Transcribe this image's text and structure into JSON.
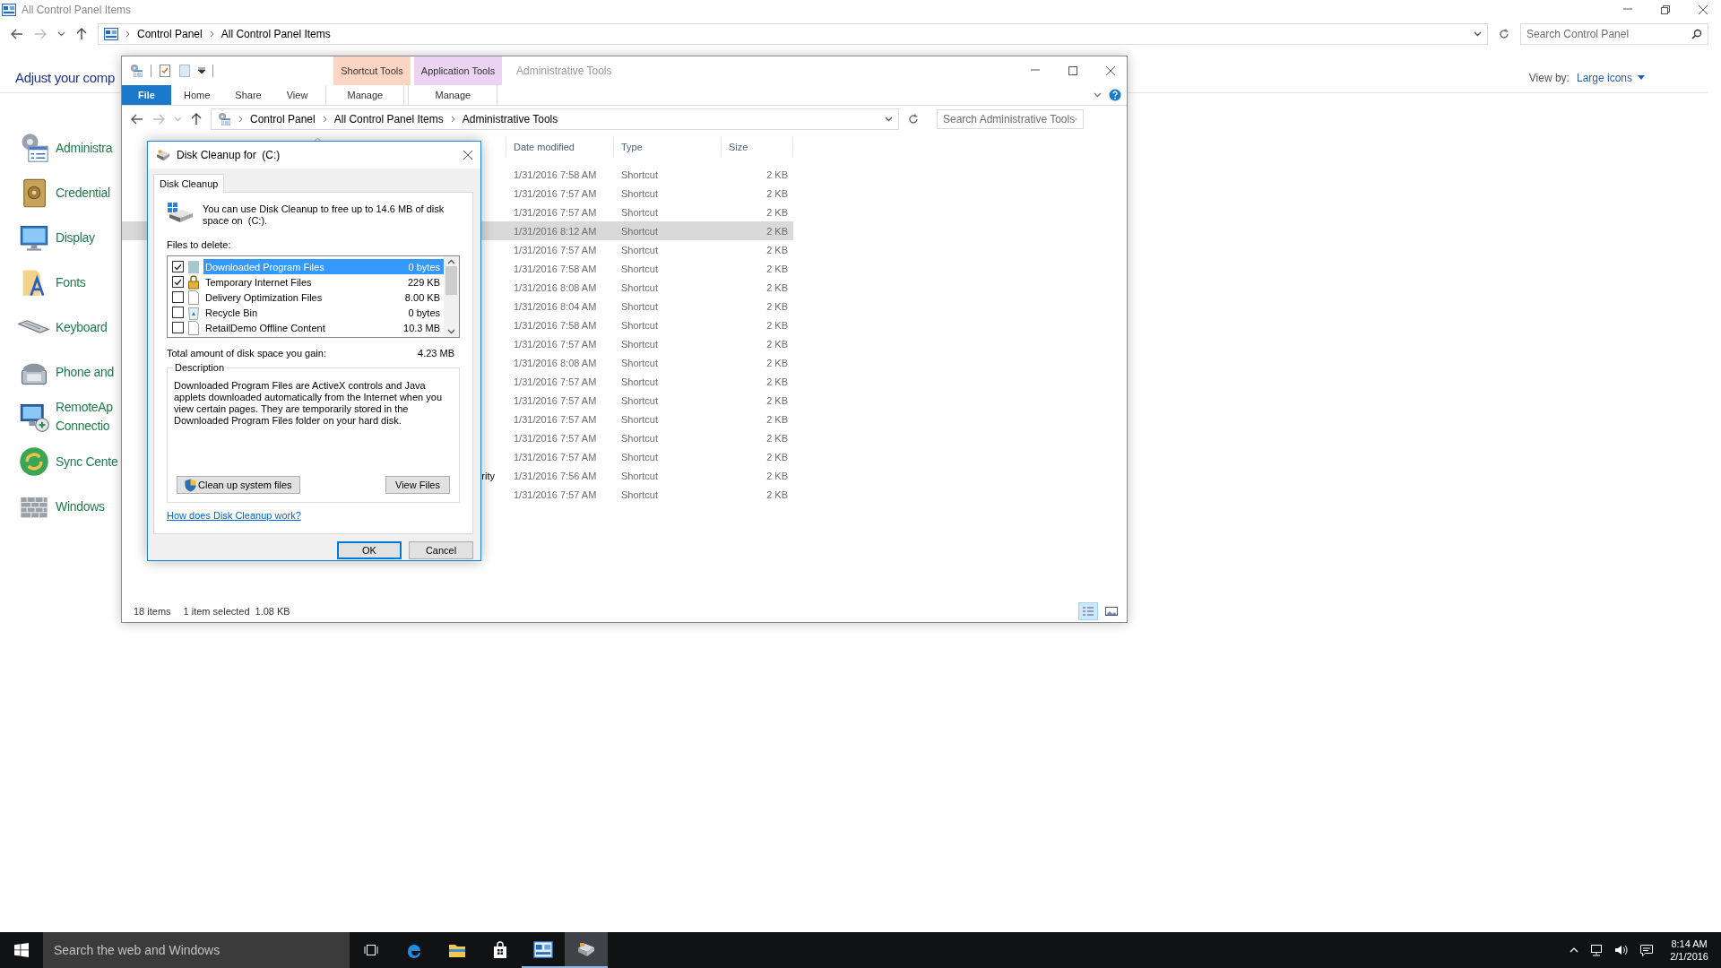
{
  "control_panel": {
    "title": "All Control Panel Items",
    "breadcrumbs": [
      "Control Panel",
      "All Control Panel Items"
    ],
    "search": {
      "placeholder": "Search Control Panel"
    },
    "heading": "Adjust your comp",
    "view_by": {
      "label": "View by:",
      "value": "Large icons"
    },
    "items": [
      {
        "kind": "admin",
        "lines": [
          "Administra"
        ]
      },
      {
        "kind": "credential",
        "lines": [
          "Credential"
        ]
      },
      {
        "kind": "display",
        "lines": [
          "Display"
        ]
      },
      {
        "kind": "fonts",
        "lines": [
          "Fonts"
        ]
      },
      {
        "kind": "keyboard",
        "lines": [
          "Keyboard"
        ]
      },
      {
        "kind": "phone",
        "lines": [
          "Phone and"
        ]
      },
      {
        "kind": "remote",
        "lines": [
          "RemoteAp",
          "Connectio"
        ]
      },
      {
        "kind": "sync",
        "lines": [
          "Sync Cente"
        ]
      },
      {
        "kind": "firewall",
        "lines": [
          "Windows"
        ]
      }
    ]
  },
  "explorer": {
    "title": "Administrative Tools",
    "contextual_groups": [
      {
        "label": "Shortcut Tools",
        "color": "#fcd6c3",
        "tab": "Manage"
      },
      {
        "label": "Application Tools",
        "color": "#ecd3f3",
        "tab": "Manage"
      }
    ],
    "tabs": [
      {
        "label": "File",
        "kind": "file"
      },
      {
        "label": "Home",
        "kind": "plain"
      },
      {
        "label": "Share",
        "kind": "plain"
      },
      {
        "label": "View",
        "kind": "plain"
      }
    ],
    "breadcrumbs": [
      "Control Panel",
      "All Control Panel Items",
      "Administrative Tools"
    ],
    "search": {
      "placeholder": "Search Administrative Tools"
    },
    "columns": [
      "Date modified",
      "Type",
      "Size"
    ],
    "rows": [
      {
        "date": "1/31/2016 7:58 AM",
        "type": "Shortcut",
        "size": "2 KB",
        "selected": false
      },
      {
        "date": "1/31/2016 7:57 AM",
        "type": "Shortcut",
        "size": "2 KB",
        "selected": false
      },
      {
        "date": "1/31/2016 7:57 AM",
        "type": "Shortcut",
        "size": "2 KB",
        "selected": false
      },
      {
        "date": "1/31/2016 8:12 AM",
        "type": "Shortcut",
        "size": "2 KB",
        "selected": true
      },
      {
        "date": "1/31/2016 7:57 AM",
        "type": "Shortcut",
        "size": "2 KB",
        "selected": false
      },
      {
        "date": "1/31/2016 7:58 AM",
        "type": "Shortcut",
        "size": "2 KB",
        "selected": false
      },
      {
        "date": "1/31/2016 8:08 AM",
        "type": "Shortcut",
        "size": "2 KB",
        "selected": false
      },
      {
        "date": "1/31/2016 8:04 AM",
        "type": "Shortcut",
        "size": "2 KB",
        "selected": false
      },
      {
        "date": "1/31/2016 7:58 AM",
        "type": "Shortcut",
        "size": "2 KB",
        "selected": false
      },
      {
        "date": "1/31/2016 7:57 AM",
        "type": "Shortcut",
        "size": "2 KB",
        "selected": false
      },
      {
        "date": "1/31/2016 8:08 AM",
        "type": "Shortcut",
        "size": "2 KB",
        "selected": false
      },
      {
        "date": "1/31/2016 7:57 AM",
        "type": "Shortcut",
        "size": "2 KB",
        "selected": false
      },
      {
        "date": "1/31/2016 7:57 AM",
        "type": "Shortcut",
        "size": "2 KB",
        "selected": false
      },
      {
        "date": "1/31/2016 7:57 AM",
        "type": "Shortcut",
        "size": "2 KB",
        "selected": false
      },
      {
        "date": "1/31/2016 7:57 AM",
        "type": "Shortcut",
        "size": "2 KB",
        "selected": false
      },
      {
        "date": "1/31/2016 7:57 AM",
        "type": "Shortcut",
        "size": "2 KB",
        "selected": false
      },
      {
        "name": "rity",
        "date": "1/31/2016 7:56 AM",
        "type": "Shortcut",
        "size": "2 KB",
        "selected": false
      },
      {
        "date": "1/31/2016 7:57 AM",
        "type": "Shortcut",
        "size": "2 KB",
        "selected": false
      }
    ],
    "status": {
      "count": "18 items",
      "selection": "1 item selected",
      "selection_size": "1.08 KB"
    },
    "views": [
      {
        "kind": "details",
        "selected": true
      },
      {
        "kind": "icons",
        "selected": false
      }
    ]
  },
  "dialog": {
    "title": "Disk Cleanup for  (C:)",
    "tab": "Disk Cleanup",
    "intro": "You can use Disk Cleanup to free up to 14.6 MB of disk space on  (C:).",
    "files_label": "Files to delete:",
    "files": [
      {
        "name": "Downloaded Program Files",
        "size": "0 bytes",
        "checked": true,
        "selected": true,
        "kind": "folder"
      },
      {
        "name": "Temporary Internet Files",
        "size": "229 KB",
        "checked": true,
        "selected": false,
        "kind": "lock"
      },
      {
        "name": "Delivery Optimization Files",
        "size": "8.00 KB",
        "checked": false,
        "selected": false,
        "kind": "page"
      },
      {
        "name": "Recycle Bin",
        "size": "0 bytes",
        "checked": false,
        "selected": false,
        "kind": "recycle"
      },
      {
        "name": "RetailDemo Offline Content",
        "size": "10.3 MB",
        "checked": false,
        "selected": false,
        "kind": "page"
      }
    ],
    "total_label": "Total amount of disk space you gain:",
    "total_value": "4.23 MB",
    "description_label": "Description",
    "description": "Downloaded Program Files are ActiveX controls and Java applets downloaded automatically from the Internet when you view certain pages. They are temporarily stored in the Downloaded Program Files folder on your hard disk.",
    "system_button": "Clean up system files",
    "view_button": "View Files",
    "link": "How does Disk Cleanup work?",
    "ok": "OK",
    "cancel": "Cancel"
  },
  "taskbar": {
    "search": {
      "placeholder": "Search the web and Windows"
    },
    "apps": [
      {
        "kind": "taskview",
        "open": false,
        "active": false
      },
      {
        "kind": "edge",
        "open": false,
        "active": false
      },
      {
        "kind": "explorer",
        "open": false,
        "active": false
      },
      {
        "kind": "store",
        "open": false,
        "active": false
      },
      {
        "kind": "controlpanel",
        "open": true,
        "active": false
      },
      {
        "kind": "cleanup",
        "open": true,
        "active": true
      }
    ],
    "clock": {
      "time": "8:14 AM",
      "date": "2/1/2016"
    }
  }
}
